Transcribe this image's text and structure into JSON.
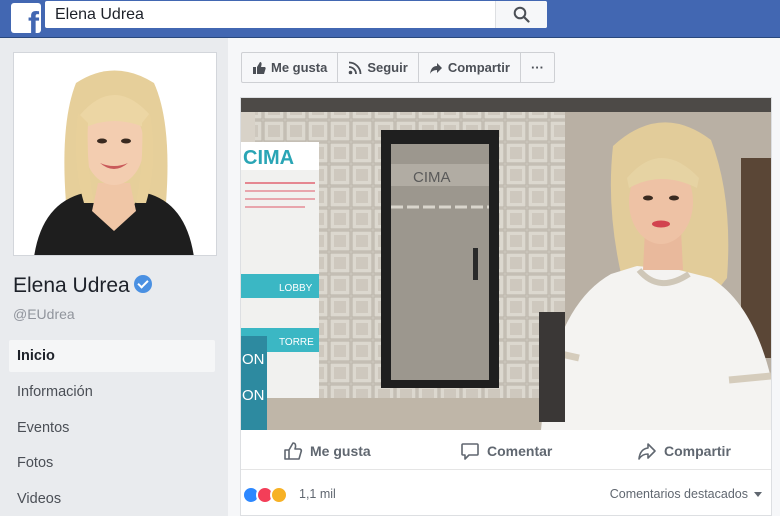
{
  "header": {
    "logo": "f",
    "search_value": "Elena Udrea",
    "search_icon": "search-icon"
  },
  "profile": {
    "name": "Elena Udrea",
    "handle": "@EUdrea",
    "verified": true
  },
  "nav": {
    "items": [
      {
        "label": "Inicio",
        "active": true
      },
      {
        "label": "Información",
        "active": false
      },
      {
        "label": "Eventos",
        "active": false
      },
      {
        "label": "Fotos",
        "active": false
      },
      {
        "label": "Videos",
        "active": false
      }
    ]
  },
  "page_actions": {
    "like": "Me gusta",
    "follow": "Seguir",
    "share": "Compartir",
    "more": "···"
  },
  "post": {
    "photo_signs": {
      "left_banner": "CIMA",
      "door_logo": "CIMA",
      "banner_lines": [
        "LOBBY",
        "TORRE"
      ],
      "edge_text": [
        "ON",
        "ON"
      ]
    },
    "actions": {
      "like": "Me gusta",
      "comment": "Comentar",
      "share": "Compartir"
    },
    "reactions": {
      "count": "1,1 mil",
      "sort_label": "Comentarios destacados"
    }
  },
  "colors": {
    "brand_blue": "#4267b2",
    "verified_blue": "#4a90e2",
    "page_bg": "#e9ebee"
  }
}
